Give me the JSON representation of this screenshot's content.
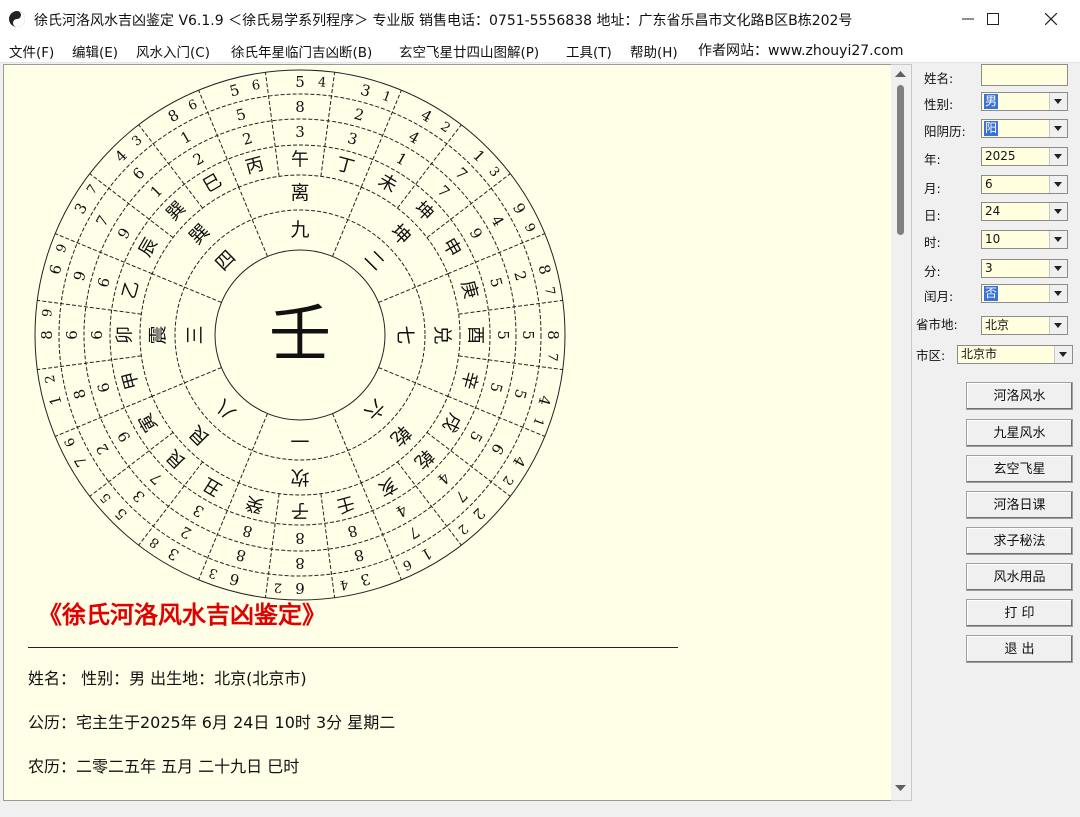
{
  "window": {
    "title": "徐氏河洛风水吉凶鉴定 V6.1.9  ＜徐氏易学系列程序＞ 专业版   销售电话：0751-5556838   地址：广东省乐昌市文化路B区B栋202号"
  },
  "menu": {
    "items": [
      "文件(F)",
      "编辑(E)",
      "风水入门(C)",
      "徐氏年星临门吉凶断(B)",
      "玄空飞星廿四山图解(P)",
      "工具(T)",
      "帮助(H)"
    ],
    "site": "作者网站：www.zhouyi27.com"
  },
  "compass": {
    "center": "壬",
    "trigrams": [
      "离",
      "坤",
      "兑",
      "乾",
      "坎",
      "艮",
      "震",
      "巽"
    ],
    "palace_numbers": [
      "九",
      "二",
      "七",
      "六",
      "一",
      "八",
      "三",
      "四"
    ],
    "mountains": [
      "丙",
      "午",
      "丁",
      "未",
      "坤",
      "申",
      "庚",
      "酉",
      "辛",
      "戌",
      "乾",
      "亥",
      "壬",
      "子",
      "癸",
      "丑",
      "艮",
      "寅",
      "甲",
      "卯",
      "乙",
      "辰",
      "巽",
      "巳"
    ],
    "inner_ring": [
      "2",
      "3",
      "3",
      "1",
      "7",
      "9",
      "5",
      "5",
      "5",
      "5",
      "4",
      "4",
      "8",
      "8",
      "8",
      "3",
      "7",
      "9",
      "6",
      "6",
      "6",
      "9",
      "1",
      "2"
    ],
    "middle_ring": [
      "5",
      "8",
      "2",
      "4",
      "7",
      "4",
      "2",
      "5",
      "5",
      "6",
      "7",
      "7",
      "8",
      "8",
      "8",
      "2",
      "3",
      "2",
      "8",
      "6",
      "9",
      "7",
      "6",
      "1"
    ],
    "outer_ring": [
      "5",
      "5",
      "3",
      "4",
      "1",
      "9",
      "8",
      "8",
      "4",
      "4",
      "2",
      "1",
      "3",
      "6",
      "6",
      "3",
      "5",
      "7",
      "1",
      "8",
      "6",
      "3",
      "4",
      "8"
    ],
    "outermost_ring": [
      "6",
      "4",
      "1",
      "2",
      "3",
      "9",
      "7",
      "7",
      "1",
      "2",
      "2",
      "6",
      "4",
      "2",
      "3",
      "8",
      "5",
      "6",
      "2",
      "9",
      "9",
      "7",
      "3",
      "6"
    ]
  },
  "report": {
    "title": "《徐氏河洛风水吉凶鉴定》",
    "line1": "姓名：   性别：男   出生地：北京(北京市)",
    "line2": "公历：宅主生于2025年 6月 24日 10时 3分 星期二",
    "line3": "农历：二零二五年  五月  二十九日  巳时"
  },
  "form": {
    "name_label": "姓名:",
    "name_value": "",
    "gender_label": "性别:",
    "gender_value": "男",
    "calendar_label": "阳阴历:",
    "calendar_value": "阳",
    "year_label": "年:",
    "year_value": "2025",
    "month_label": "月:",
    "month_value": "6",
    "day_label": "日:",
    "day_value": "24",
    "hour_label": "时:",
    "hour_value": "10",
    "minute_label": "分:",
    "minute_value": "3",
    "leap_label": "闰月:",
    "leap_value": "否",
    "province_label": "省市地:",
    "province_value": "北京",
    "district_label": "市区:",
    "district_value": "北京市"
  },
  "buttons": [
    "河洛风水",
    "九星风水",
    "玄空飞星",
    "河洛日课",
    "求子秘法",
    "风水用品",
    "打  印",
    "退  出"
  ]
}
